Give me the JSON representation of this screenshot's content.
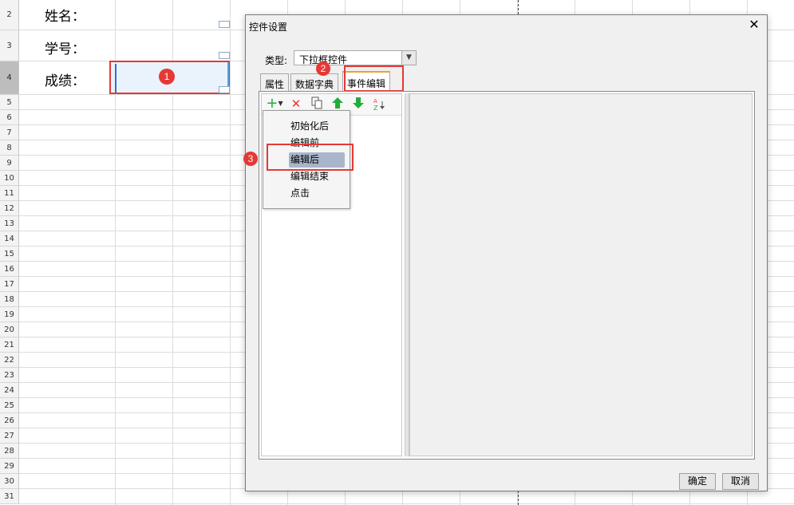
{
  "sheet": {
    "row_numbers": [
      "2",
      "3",
      "4",
      "5",
      "6",
      "7",
      "8",
      "9",
      "10",
      "11",
      "12",
      "13",
      "14",
      "15",
      "16",
      "17",
      "18",
      "19",
      "20",
      "21",
      "22",
      "23",
      "24",
      "25",
      "26",
      "27",
      "28",
      "29",
      "30",
      "31"
    ],
    "labels": {
      "name": "姓名：",
      "student_id": "学号：",
      "score": "成绩："
    }
  },
  "badges": {
    "one": "1",
    "two": "2",
    "three": "3"
  },
  "dialog": {
    "title": "控件设置",
    "close": "✕",
    "type_label": "类型:",
    "type_value": "下拉框控件",
    "tabs": [
      "属性",
      "数据字典",
      "事件编辑"
    ],
    "active_tab": "事件编辑",
    "toolbar_icons": [
      "add-icon",
      "delete-icon",
      "copy-icon",
      "move-up-icon",
      "move-down-icon",
      "sort-icon"
    ],
    "menu_items": [
      "初始化后",
      "编辑前",
      "编辑后",
      "编辑结束",
      "点击"
    ],
    "hovered_item": "编辑后",
    "ok": "确定",
    "cancel": "取消"
  },
  "colors": {
    "highlight": "#e53935",
    "up_down_green": "#1fae3a",
    "delete_red": "#e53935"
  }
}
